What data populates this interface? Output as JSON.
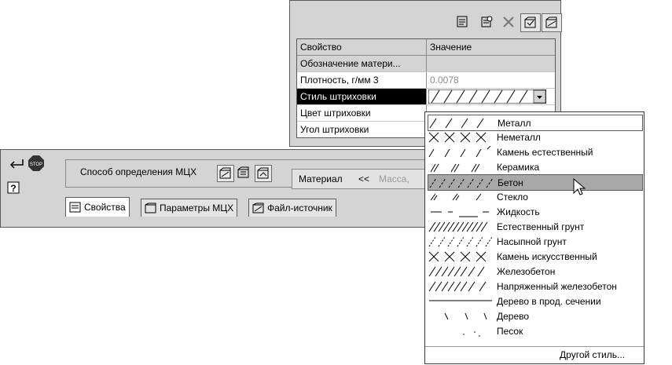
{
  "properties_panel": {
    "toolbar_icons": [
      "properties-icon",
      "parameters-icon",
      "delete-icon",
      "mch-icon",
      "source-icon"
    ],
    "header": {
      "property": "Свойство",
      "value": "Значение"
    },
    "rows": [
      {
        "property": "Обозначение матери...",
        "value": ""
      },
      {
        "property": "Плотность, г/мм 3",
        "value": "0.0078"
      },
      {
        "property": "Стиль штриховки",
        "value": ""
      },
      {
        "property": "Цвет штриховки",
        "value": ""
      },
      {
        "property": "Угол штриховки",
        "value": ""
      }
    ]
  },
  "bottom_panel": {
    "mch_method_label": "Способ определения МЦХ",
    "material_label": "Материал",
    "material_collapse": "<<",
    "mass_label": "Масса,",
    "tabs": [
      {
        "label": "Свойства"
      },
      {
        "label": "Параметры МЦХ"
      },
      {
        "label": "Файл-источник"
      }
    ]
  },
  "hatch_dropdown": {
    "items": [
      {
        "label": "Металл",
        "pattern": "metal"
      },
      {
        "label": "Неметалл",
        "pattern": "nonmetal"
      },
      {
        "label": "Камень естественный",
        "pattern": "natural-stone"
      },
      {
        "label": "Керамика",
        "pattern": "ceramic"
      },
      {
        "label": "Бетон",
        "pattern": "concrete"
      },
      {
        "label": "Стекло",
        "pattern": "glass"
      },
      {
        "label": "Жидкость",
        "pattern": "liquid"
      },
      {
        "label": "Естественный грунт",
        "pattern": "natural-soil"
      },
      {
        "label": "Насыпной грунт",
        "pattern": "bulk-soil"
      },
      {
        "label": "Камень искусственный",
        "pattern": "artificial-stone"
      },
      {
        "label": "Железобетон",
        "pattern": "reinforced-concrete"
      },
      {
        "label": "Напряженный железобетон",
        "pattern": "prestressed-concrete"
      },
      {
        "label": "Дерево в прод. сечении",
        "pattern": "wood-long"
      },
      {
        "label": "Дерево",
        "pattern": "wood"
      },
      {
        "label": "Песок",
        "pattern": "sand"
      }
    ],
    "selected_label": "Бетон",
    "other_style": "Другой стиль..."
  }
}
